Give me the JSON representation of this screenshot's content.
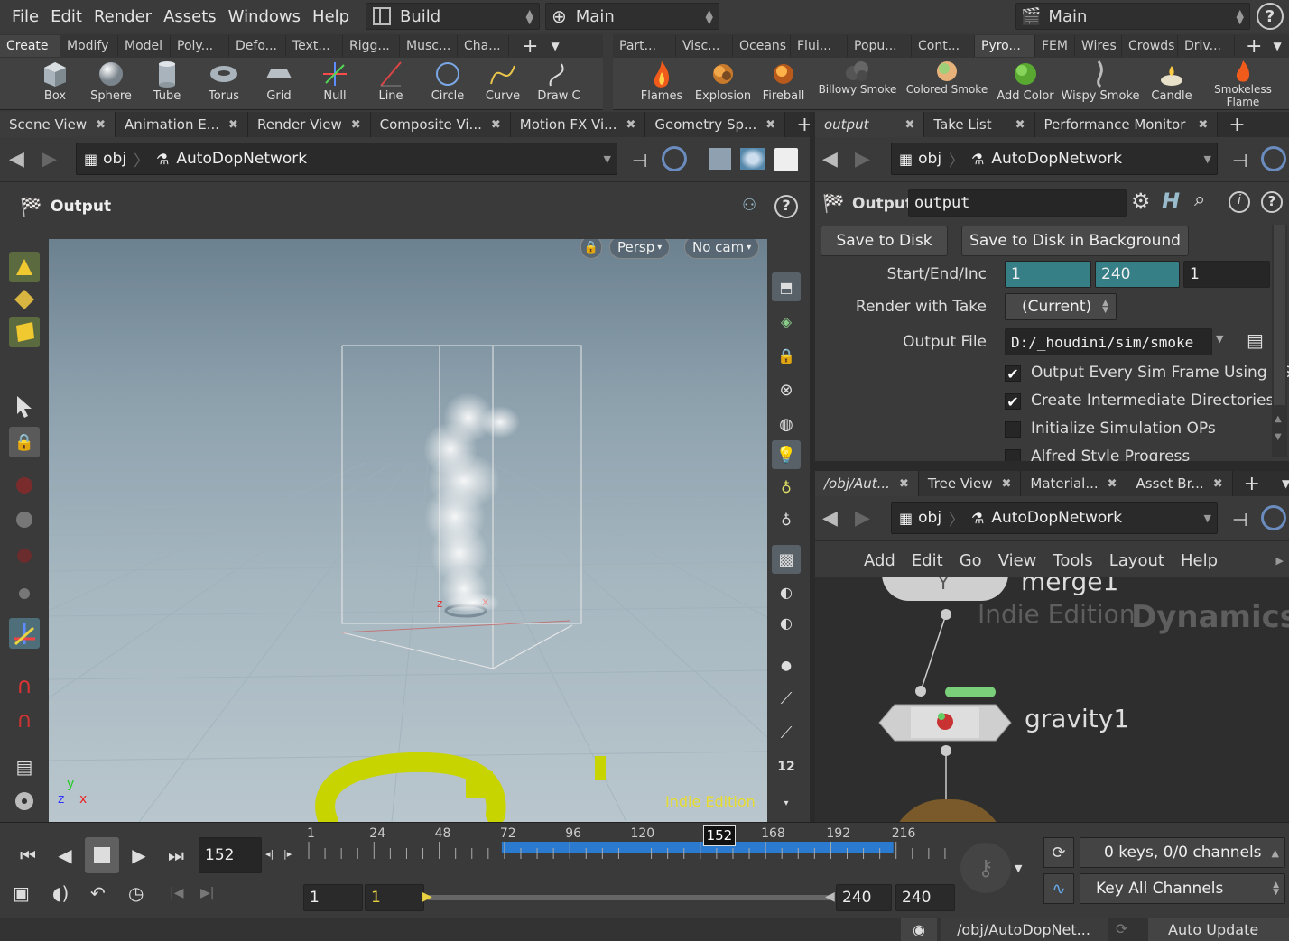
{
  "menubar": {
    "items": [
      "File",
      "Edit",
      "Render",
      "Assets",
      "Windows",
      "Help"
    ],
    "desktop_label": "Build",
    "mode_label": "Main",
    "main_right": "Main"
  },
  "shelf_left": {
    "tabs": [
      "Create",
      "Modify",
      "Model",
      "Poly...",
      "Defo...",
      "Text...",
      "Rigg...",
      "Musc...",
      "Cha..."
    ],
    "tools": [
      "Box",
      "Sphere",
      "Tube",
      "Torus",
      "Grid",
      "Null",
      "Line",
      "Circle",
      "Curve",
      "Draw C"
    ]
  },
  "shelf_right": {
    "tabs": [
      "Part...",
      "Visc...",
      "Oceans",
      "Flui...",
      "Popu...",
      "Cont...",
      "Pyro...",
      "FEM",
      "Wires",
      "Crowds",
      "Driv..."
    ],
    "tools": [
      "Flames",
      "Explosion",
      "Fireball",
      "Billowy Smoke",
      "Colored Smoke",
      "Add Color",
      "Wispy Smoke",
      "Candle",
      "Smokeless Flame"
    ]
  },
  "left_tabs": [
    "Scene View",
    "Animation E...",
    "Render View",
    "Composite Vi...",
    "Motion FX Vi...",
    "Geometry Sp..."
  ],
  "right_top_tabs": [
    "output",
    "Take List",
    "Performance Monitor"
  ],
  "right_bottom_tabs": [
    "/obj/Aut...",
    "Tree View",
    "Material...",
    "Asset Br..."
  ],
  "path": {
    "obj": "obj",
    "network": "AutoDopNetwork"
  },
  "viewer": {
    "title": "Output",
    "persp": "Persp",
    "cam": "No cam",
    "watermark": "Indie Edition",
    "axis_y": "y",
    "axis_z": "z",
    "axis_x": "x",
    "side_number": "12"
  },
  "params": {
    "node_type": "Output",
    "node_name": "output",
    "save_btn": "Save to Disk",
    "save_bg_btn": "Save to Disk in Background",
    "start_end_label": "Start/End/Inc",
    "start": "1",
    "end": "240",
    "inc": "1",
    "take_label": "Render with Take",
    "take_value": "(Current)",
    "file_label": "Output File",
    "file_value": "D:/_houdini/sim/smoke",
    "checks": [
      {
        "label": "Output Every Sim Frame Using $SF",
        "checked": true
      },
      {
        "label": "Create Intermediate Directories",
        "checked": true
      },
      {
        "label": "Initialize Simulation OPs",
        "checked": false
      },
      {
        "label": "Alfred Style Progress",
        "checked": false
      }
    ]
  },
  "network": {
    "menu": [
      "Add",
      "Edit",
      "Go",
      "View",
      "Tools",
      "Layout",
      "Help"
    ],
    "node_top": "merge1",
    "node_main": "gravity1",
    "watermark_a": "Indie Edition",
    "watermark_b": "Dynamics"
  },
  "timeline": {
    "current_frame": "152",
    "ticks": [
      "1",
      "24",
      "48",
      "72",
      "96",
      "120",
      "152",
      "168",
      "192",
      "216"
    ],
    "range_start": "1",
    "range_start2": "1",
    "range_end": "240",
    "range_end2": "240",
    "cache_start_frame": 72,
    "cache_end_frame": 216,
    "total_frames": 240,
    "keys_info": "0 keys, 0/0 channels",
    "key_all": "Key All Channels"
  },
  "status": {
    "path": "/obj/AutoDopNet...",
    "update": "Auto Update"
  }
}
